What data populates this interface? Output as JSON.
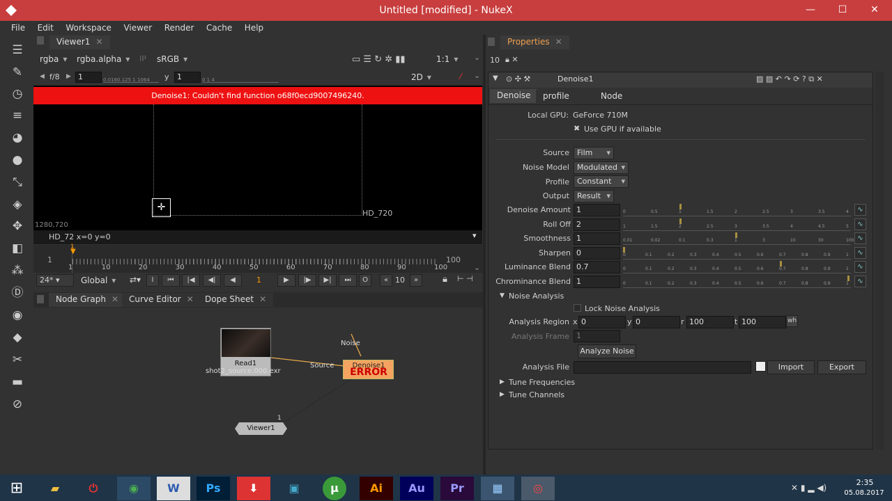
{
  "window": {
    "title": "Untitled [modified] - NukeX",
    "min": "—",
    "max": "☐",
    "close": "✕"
  },
  "menu": [
    "File",
    "Edit",
    "Workspace",
    "Viewer",
    "Render",
    "Cache",
    "Help"
  ],
  "viewer": {
    "tab": "Viewer1",
    "channels": "rgba",
    "channel2": "rgba.alpha",
    "ip": "IP",
    "lut": "sRGB",
    "zoom": "1:1",
    "fstop": "f/8",
    "gain": "1",
    "gamma_label": "y",
    "gamma": "1",
    "view_mode": "2D",
    "error": "Denoise1: Couldn't find function o68f0ecd9007496240.",
    "format_label": "HD_720",
    "resolution": "1280,720",
    "status": "HD_72  x=0 y=0",
    "gain_ticks": "0.0160.125  1  1064",
    "gamma_ticks": "0        1        4"
  },
  "timeline": {
    "start": "1",
    "end": "100",
    "ticks": [
      "1",
      "10",
      "20",
      "30",
      "40",
      "50",
      "60",
      "70",
      "80",
      "90",
      "100"
    ],
    "fps": "24*",
    "scope": "Global",
    "frame": "1",
    "step": "10",
    "cur": "1"
  },
  "nodegraph": {
    "tabs": [
      "Node Graph",
      "Curve Editor",
      "Dope Sheet"
    ],
    "read_node": "Read1",
    "read_file": "shot2_source.000.exr",
    "denoise_node": "Denoise1",
    "error_text": "ERROR",
    "source_label": "Source",
    "noise_label": "Noise",
    "viewer_node": "Viewer1",
    "viewer_input": "1"
  },
  "properties": {
    "tab": "Properties",
    "count": "10",
    "node_name": "Denoise1",
    "tabs": [
      "Denoise",
      "profile",
      "Node"
    ],
    "gpu_label": "Local GPU:",
    "gpu_value": "GeForce 710M",
    "use_gpu": "Use GPU if available",
    "source_label": "Source",
    "source": "Film",
    "noise_model_label": "Noise Model",
    "noise_model": "Modulated",
    "profile_label": "Profile",
    "profile": "Constant",
    "output_label": "Output",
    "output": "Result",
    "sliders": [
      {
        "label": "Denoise Amount",
        "value": "1",
        "ticks": [
          "0",
          "0.5",
          "1",
          "1.5",
          "2",
          "2.5",
          "3",
          "3.5",
          "4"
        ],
        "fraction": 0.25
      },
      {
        "label": "Roll Off",
        "value": "2",
        "ticks": [
          "1",
          "1.5",
          "2",
          "2.5",
          "3",
          "3.5",
          "4",
          "4.5",
          "5"
        ],
        "fraction": 0.25
      },
      {
        "label": "Smoothness",
        "value": "1",
        "ticks": [
          "0.01",
          "0.02",
          "0.1",
          "0.3",
          "1",
          "3",
          "10",
          "30",
          "100"
        ],
        "fraction": 0.5
      },
      {
        "label": "Sharpen",
        "value": "0",
        "ticks": [
          "0",
          "0.1",
          "0.2",
          "0.3",
          "0.4",
          "0.5",
          "0.6",
          "0.7",
          "0.8",
          "0.9",
          "1"
        ],
        "fraction": 0
      },
      {
        "label": "Luminance Blend",
        "value": "0.7",
        "ticks": [
          "0",
          "0.1",
          "0.2",
          "0.3",
          "0.4",
          "0.5",
          "0.6",
          "0.7",
          "0.8",
          "0.9",
          "1"
        ],
        "fraction": 0.7
      },
      {
        "label": "Chrominance Blend",
        "value": "1",
        "ticks": [
          "0",
          "0.1",
          "0.2",
          "0.3",
          "0.4",
          "0.5",
          "0.6",
          "0.7",
          "0.8",
          "0.9",
          "1"
        ],
        "fraction": 1
      }
    ],
    "noise_analysis": "Noise Analysis",
    "lock_noise": "Lock Noise Analysis",
    "region_label": "Analysis Region",
    "region": {
      "x_l": "x",
      "x": "0",
      "y_l": "y",
      "y": "0",
      "r_l": "r",
      "r": "100",
      "t_l": "t",
      "t": "100",
      "wh": "wh"
    },
    "frame_label": "Analysis Frame",
    "frame": "1",
    "analyze_btn": "Analyze Noise",
    "file_label": "Analysis File",
    "import_btn": "Import",
    "export_btn": "Export",
    "tune_freq": "Tune Frequencies",
    "tune_channels": "Tune Channels"
  },
  "taskbar": {
    "time": "2:35",
    "date": "05.08.2017",
    "apps": [
      "W",
      "Ps",
      "Ai",
      "Au",
      "Pr"
    ]
  }
}
